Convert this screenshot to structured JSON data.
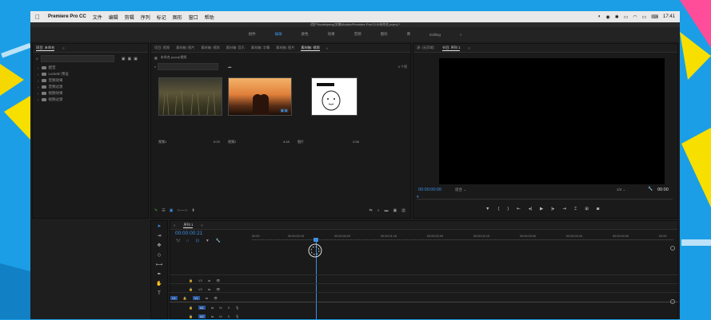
{
  "menubar": {
    "app_name": "Premiere Pro CC",
    "items": [
      "文件",
      "编辑",
      "剪辑",
      "序列",
      "标记",
      "图形",
      "窗口",
      "帮助"
    ],
    "time": "17:41"
  },
  "window": {
    "title": "/用户/hualeipeng/文稿/Adobe/Premiere Pro/13.0/未命名.prproj *"
  },
  "workspaces": {
    "items": [
      "组件",
      "编辑",
      "颜色",
      "效果",
      "音频",
      "图形",
      "库",
      "Editing"
    ],
    "active_index": 1,
    "more": "»"
  },
  "project_panel": {
    "tab": "项目: 未命名",
    "search_placeholder": "",
    "tree": [
      "配音",
      "Lumetri 预设",
      "音频效果",
      "音频过渡",
      "视频效果",
      "视频过渡"
    ]
  },
  "media_panel": {
    "tabs": [
      "项目: 视频",
      "素材箱: 图片",
      "素材箱: 视频",
      "素材箱: 音乐",
      "素材箱: 字幕",
      "素材箱: 图片",
      "素材箱: 视频"
    ],
    "active_tab": 6,
    "path": "未命名.prproj\\视频",
    "count": "3 个项",
    "clips": [
      {
        "name": "视频1",
        "duration": "0:23"
      },
      {
        "name": "视频2",
        "duration": "4:18"
      },
      {
        "name": "图片",
        "duration": "2:08"
      }
    ]
  },
  "program_monitor": {
    "tabs": [
      "源: (无剪辑)",
      "节目: 序列 1"
    ],
    "active_tab": 1,
    "timecode": "00:00:00:00",
    "fit": "适合",
    "ratio": "1/2",
    "end_timecode": "00:00"
  },
  "timeline": {
    "tab": "序列 1",
    "timecode": "00:00:00:21",
    "ruler": [
      "00:00",
      "00:00:00:15",
      "00:00:00:20",
      "00:00:01:15",
      "00:00:02:00",
      "00:00:02:15",
      "00:00:03:00",
      "00:00:03:15",
      "00:00:04:00",
      "00:00"
    ],
    "video_tracks": [
      "V3",
      "V2",
      "V1"
    ],
    "audio_tracks": [
      "A1",
      "A2"
    ],
    "source_label_v": "V1",
    "source_label_a": "A1"
  },
  "colors": {
    "accent": "#3d8fe0",
    "bg_blue": "#1b9ee6",
    "panel": "#1a1a1a"
  }
}
